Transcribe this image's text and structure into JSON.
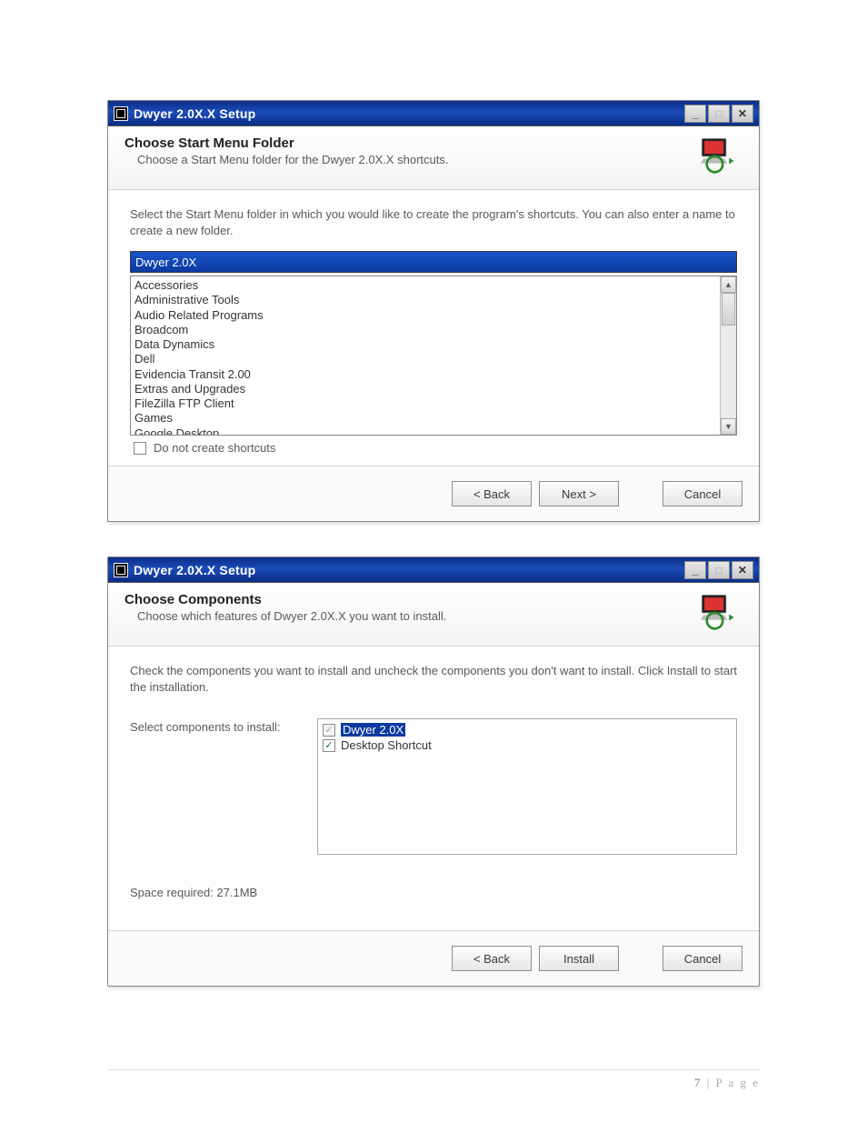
{
  "footer": {
    "page_number": "7",
    "page_label": " | P a g e"
  },
  "window1": {
    "title": "Dwyer 2.0X.X Setup",
    "header_title": "Choose Start Menu Folder",
    "header_desc": "Choose a Start Menu folder for the Dwyer 2.0X.X shortcuts.",
    "instruction": "Select the Start Menu folder in which you would like to create the program's shortcuts. You can also enter a name to create a new folder.",
    "folder_input_value": "Dwyer 2.0X",
    "folder_list": [
      "Accessories",
      "Administrative Tools",
      "Audio Related Programs",
      "Broadcom",
      "Data Dynamics",
      "Dell",
      "Evidencia Transit 2.00",
      "Extras and Upgrades",
      "FileZilla FTP Client",
      "Games",
      "Google Desktop"
    ],
    "no_shortcuts_label": "Do not create shortcuts",
    "buttons": {
      "back": "< Back",
      "next": "Next >",
      "cancel": "Cancel"
    }
  },
  "window2": {
    "title": "Dwyer 2.0X.X Setup",
    "header_title": "Choose Components",
    "header_desc": "Choose which features of Dwyer 2.0X.X you want to install.",
    "instruction": "Check the components you want to install and uncheck the components you don't want to install. Click Install to start the installation.",
    "select_label": "Select components to install:",
    "components": {
      "item1": "Dwyer 2.0X",
      "item2": "Desktop Shortcut"
    },
    "space_required": "Space required: 27.1MB",
    "buttons": {
      "back": "< Back",
      "install": "Install",
      "cancel": "Cancel"
    }
  },
  "titlebar_icons": {
    "minimize": "_",
    "maximize": "□",
    "close": "✕"
  }
}
